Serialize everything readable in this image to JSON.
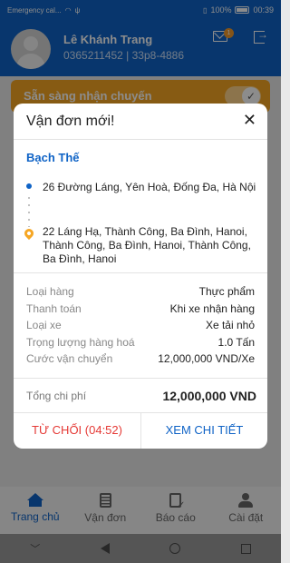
{
  "status_bar": {
    "carrier": "Emergency cal...",
    "battery": "100%",
    "time": "00:39"
  },
  "header": {
    "user_name": "Lê Khánh Trang",
    "user_sub": "0365211452 | 33p8-4886",
    "mail_badge": "1"
  },
  "ready_banner": {
    "label": "Sẵn sàng nhận chuyến"
  },
  "dialog": {
    "title": "Vận đơn mới!",
    "close": "✕",
    "company": "Bạch Thế",
    "pickup_address": "26 Đường Láng, Yên Hoà, Đống Đa, Hà Nội",
    "dropoff_address": "22 Láng Hạ, Thành Công, Ba Đình, Hanoi, Thành Công, Ba Đình, Hanoi, Thành Công, Ba Đình, Hanoi",
    "details": [
      {
        "label": "Loại hàng",
        "value": "Thực phẩm"
      },
      {
        "label": "Thanh toán",
        "value": "Khi xe nhận hàng"
      },
      {
        "label": "Loại xe",
        "value": "Xe tải nhỏ"
      },
      {
        "label": "Trọng lượng hàng hoá",
        "value": "1.0 Tấn"
      },
      {
        "label": "Cước vận chuyển",
        "value": "12,000,000 VND/Xe"
      }
    ],
    "total_label": "Tổng chi phí",
    "total_value": "12,000,000 VND",
    "reject_button": "TỪ CHỐI (04:52)",
    "detail_button": "XEM CHI TIẾT"
  },
  "bottom_nav": [
    {
      "label": "Trang chủ",
      "icon": "home-icon",
      "active": true
    },
    {
      "label": "Vận đơn",
      "icon": "document-icon",
      "active": false
    },
    {
      "label": "Báo cáo",
      "icon": "report-icon",
      "active": false
    },
    {
      "label": "Cài đặt",
      "icon": "settings-icon",
      "active": false
    }
  ],
  "colors": {
    "primary": "#0f63c6",
    "accent": "#f6a623",
    "danger": "#e53935"
  }
}
